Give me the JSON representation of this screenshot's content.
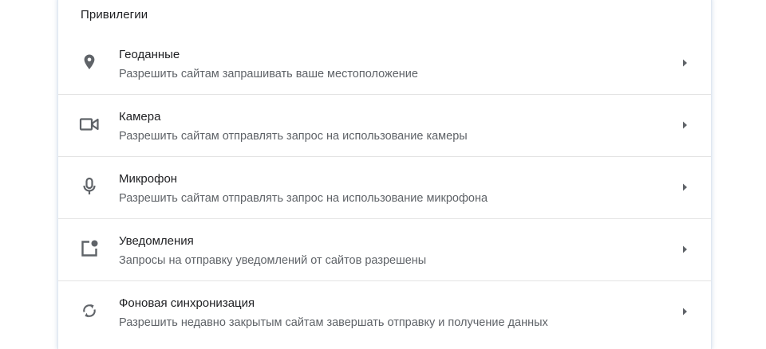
{
  "section": {
    "title": "Привилегии"
  },
  "items": [
    {
      "icon": "location-pin-icon",
      "title": "Геоданные",
      "subtitle": "Разрешить сайтам запрашивать ваше местоположение"
    },
    {
      "icon": "camera-icon",
      "title": "Камера",
      "subtitle": "Разрешить сайтам отправлять запрос на использование камеры"
    },
    {
      "icon": "microphone-icon",
      "title": "Микрофон",
      "subtitle": "Разрешить сайтам отправлять запрос на использование микрофона"
    },
    {
      "icon": "notifications-icon",
      "title": "Уведомления",
      "subtitle": "Запросы на отправку уведомлений от сайтов разрешены"
    },
    {
      "icon": "sync-icon",
      "title": "Фоновая синхронизация",
      "subtitle": "Разрешить недавно закрытым сайтам завершать отправку и получение данных"
    }
  ],
  "colors": {
    "icon": "#5f6368",
    "title": "#202124",
    "subtitle": "#5f6368",
    "divider": "#e3e3e3"
  }
}
